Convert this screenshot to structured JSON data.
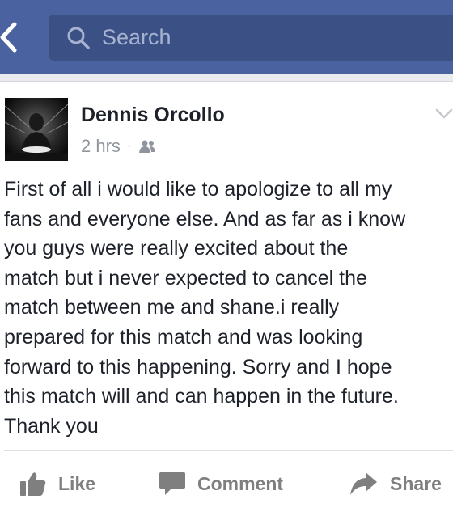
{
  "colors": {
    "header_bg": "#4a63a0",
    "search_bg": "#3b5186",
    "search_text": "#a6b2d0",
    "text": "#1d2129",
    "meta_text": "#90949c",
    "action_text": "#7f7f7f"
  },
  "header": {
    "back_icon": "chevron-left-icon",
    "search": {
      "icon": "search-icon",
      "placeholder": "Search"
    }
  },
  "post": {
    "author": "Dennis Orcollo",
    "time": "2 hrs",
    "separator": "·",
    "audience_icon": "friends-icon",
    "menu_icon": "chevron-down-icon",
    "text": "First of all i would like to apologize to all my\nfans and everyone else. And as far as i know\nyou guys were really excited about the\nmatch but i never expected to cancel the\nmatch between me and shane.i really\nprepared for this match and was looking\nforward to this happening. Sorry and I hope\nthis match will and can happen in the future.\nThank you"
  },
  "actions": {
    "like": {
      "label": "Like",
      "icon": "thumbs-up-icon"
    },
    "comment": {
      "label": "Comment",
      "icon": "speech-bubble-icon"
    },
    "share": {
      "label": "Share",
      "icon": "share-arrow-icon"
    }
  }
}
